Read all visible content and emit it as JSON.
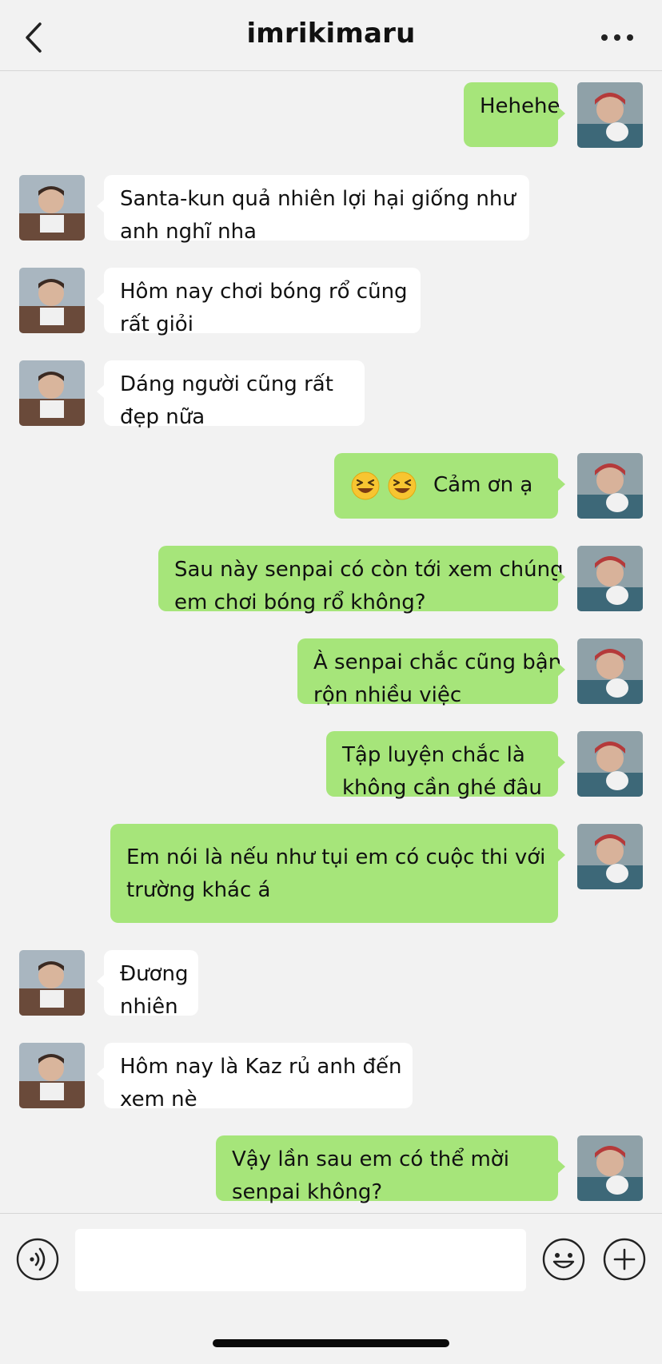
{
  "header": {
    "title": "imrikimaru",
    "back_icon": "chevron-left-icon",
    "more_icon": "more-horizontal-icon"
  },
  "messages": [
    {
      "side": "right",
      "lines": [
        "Hehehe"
      ]
    },
    {
      "side": "left",
      "lines": [
        "Santa-kun quả nhiên lợi hại giống như",
        "anh nghĩ nha"
      ]
    },
    {
      "side": "left",
      "lines": [
        "Hôm nay chơi bóng rổ cũng",
        "rất giỏi"
      ]
    },
    {
      "side": "left",
      "lines": [
        "Dáng người cũng rất",
        "đẹp nữa"
      ]
    },
    {
      "side": "right",
      "emojis": [
        "laughing-face-emoji",
        "laughing-face-emoji"
      ],
      "lines": [
        "Cảm ơn ạ"
      ]
    },
    {
      "side": "right",
      "lines": [
        "Sau này senpai có còn tới xem chúng",
        "em chơi bóng rổ không?"
      ]
    },
    {
      "side": "right",
      "lines": [
        "À senpai chắc cũng bận",
        "rộn nhiều việc"
      ]
    },
    {
      "side": "right",
      "lines": [
        "Tập luyện chắc là",
        "không cần ghé đâu"
      ]
    },
    {
      "side": "right",
      "lines": [
        "Em nói là nếu như tụi em có cuộc thi với",
        "trường khác á"
      ]
    },
    {
      "side": "left",
      "lines": [
        "Đương",
        "nhiên"
      ]
    },
    {
      "side": "left",
      "lines": [
        "Hôm nay là Kaz rủ anh đến",
        "xem nè"
      ]
    },
    {
      "side": "right",
      "lines": [
        "Vậy lần sau em có thể mời",
        "senpai không?"
      ]
    }
  ],
  "input_bar": {
    "text_value": "",
    "voice_icon": "voice-icon",
    "emoji_icon": "emoji-icon",
    "plus_icon": "plus-icon"
  },
  "colors": {
    "background": "#f2f2f2",
    "incoming_bubble": "#ffffff",
    "outgoing_bubble": "#a6e57a",
    "text": "#111111"
  }
}
